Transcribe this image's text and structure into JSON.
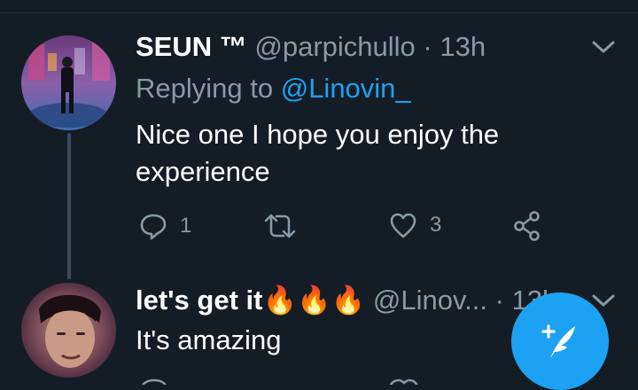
{
  "colors": {
    "background": "#141d26",
    "secondary_text": "#8899a6",
    "link": "#1da1f2",
    "fab": "#1da1f2"
  },
  "tweet1": {
    "display_name": "SEUN ™",
    "handle": "@parpichullo",
    "separator": "·",
    "time": "13h",
    "reply_prefix": "Replying to",
    "reply_to": "@Linovin_",
    "text": "Nice one I hope you enjoy the experience",
    "actions": {
      "reply_icon": "reply-bubble-icon",
      "reply_count": "1",
      "retweet_icon": "retweet-icon",
      "like_icon": "heart-icon",
      "like_count": "3",
      "share_icon": "share-icon"
    },
    "menu_icon": "chevron-down-icon"
  },
  "tweet2": {
    "display_name": "let's get it🔥🔥🔥",
    "handle": "@Linov...",
    "separator": "·",
    "time": "13h",
    "text": "It's amazing",
    "menu_icon": "chevron-down-icon"
  },
  "fab": {
    "icon": "compose-feather-icon"
  }
}
